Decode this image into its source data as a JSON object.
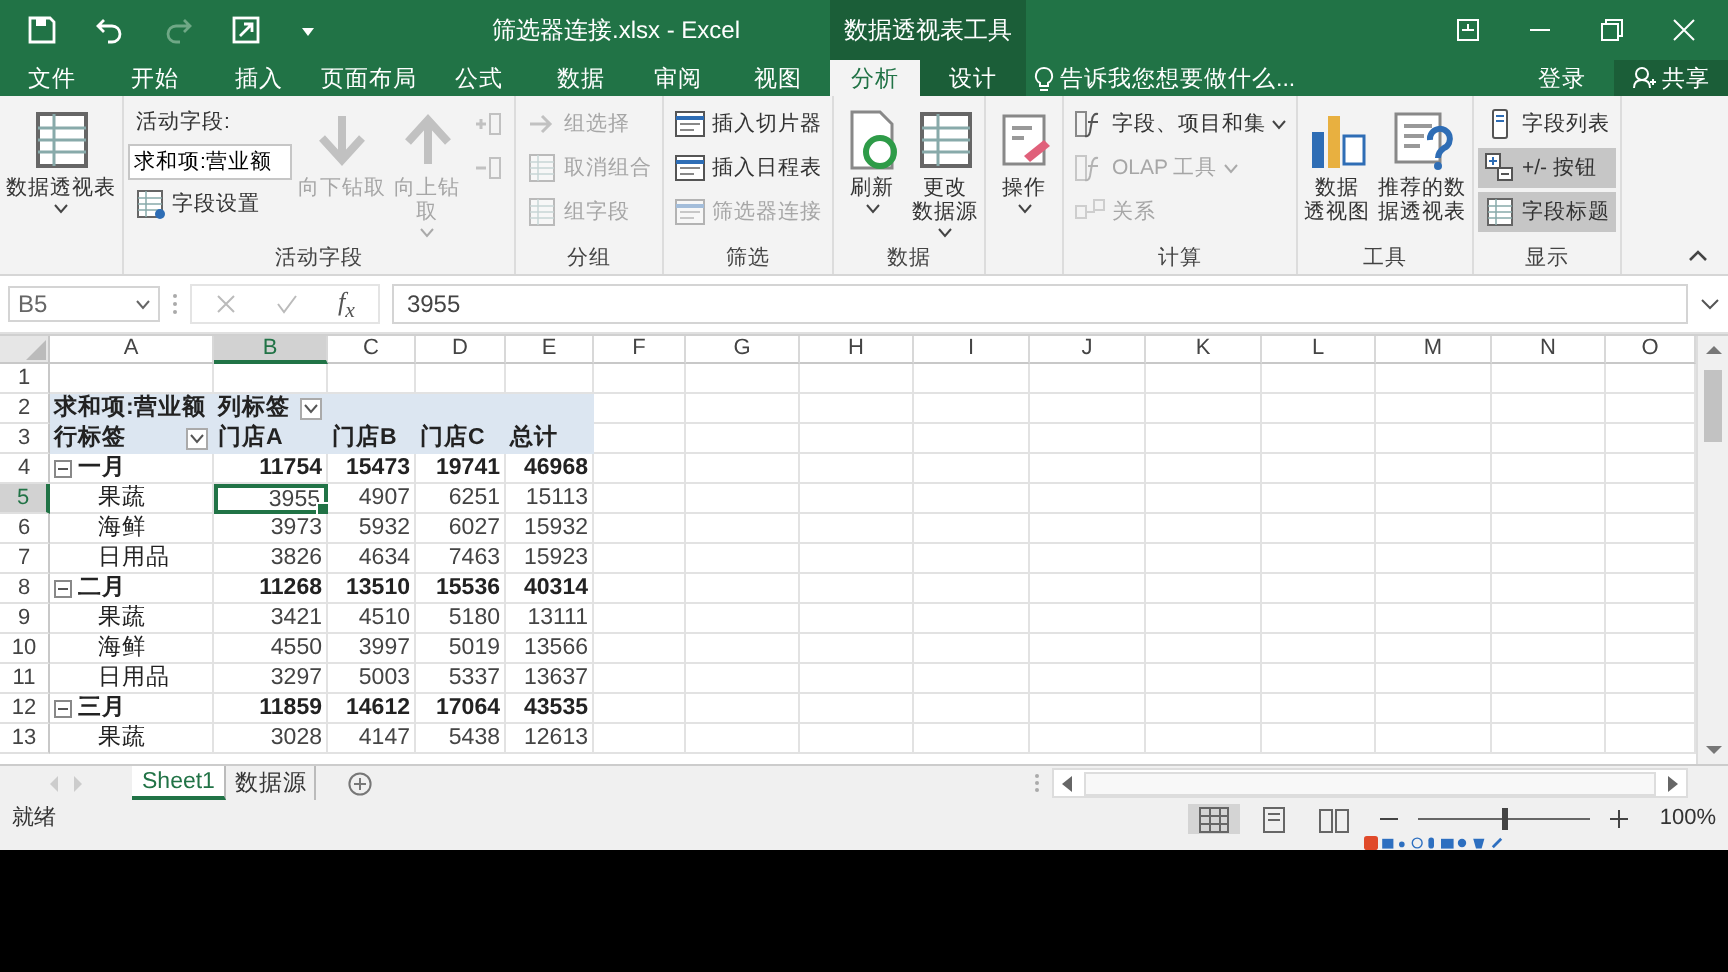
{
  "title_bar": {
    "title": "筛选器连接.xlsx - Excel",
    "context_label": "数据透视表工具"
  },
  "menu": {
    "tabs": [
      {
        "label": "文件",
        "selected": false,
        "contextual": false
      },
      {
        "label": "开始",
        "selected": false,
        "contextual": false
      },
      {
        "label": "插入",
        "selected": false,
        "contextual": false
      },
      {
        "label": "页面布局",
        "selected": false,
        "contextual": false
      },
      {
        "label": "公式",
        "selected": false,
        "contextual": false
      },
      {
        "label": "数据",
        "selected": false,
        "contextual": false
      },
      {
        "label": "审阅",
        "selected": false,
        "contextual": false
      },
      {
        "label": "视图",
        "selected": false,
        "contextual": false
      },
      {
        "label": "分析",
        "selected": true,
        "contextual": true
      },
      {
        "label": "设计",
        "selected": false,
        "contextual": true
      }
    ],
    "tell_me": "告诉我您想要做什么...",
    "sign_in": "登录",
    "share": "共享"
  },
  "ribbon": [
    {
      "items": [
        {
          "kind": "large",
          "label": "数据透视表",
          "disabled": false,
          "dropdown": true
        }
      ]
    },
    {
      "label": "活动字段",
      "items": [
        {
          "kind": "stack",
          "items": [
            {
              "kind": "caption",
              "label": "活动字段:"
            },
            {
              "kind": "field",
              "value": "求和项:营业额"
            },
            {
              "kind": "small",
              "label": "字段设置",
              "disabled": false
            }
          ]
        },
        {
          "kind": "large",
          "label": "向下钻取",
          "disabled": true,
          "dropdown": false
        },
        {
          "kind": "large",
          "label": "向上钻取",
          "disabled": true,
          "dropdown": true
        },
        {
          "kind": "stack",
          "items": [
            {
              "kind": "icon",
              "disabled": true
            },
            {
              "kind": "icon",
              "disabled": true
            }
          ]
        }
      ]
    },
    {
      "label": "分组",
      "items": [
        {
          "kind": "stack",
          "items": [
            {
              "kind": "small",
              "label": "组选择",
              "disabled": true
            },
            {
              "kind": "small",
              "label": "取消组合",
              "disabled": true
            },
            {
              "kind": "small",
              "label": "组字段",
              "disabled": true
            }
          ]
        }
      ]
    },
    {
      "label": "筛选",
      "items": [
        {
          "kind": "stack",
          "items": [
            {
              "kind": "small",
              "label": "插入切片器",
              "disabled": false
            },
            {
              "kind": "small",
              "label": "插入日程表",
              "disabled": false
            },
            {
              "kind": "small",
              "label": "筛选器连接",
              "disabled": true
            }
          ]
        }
      ]
    },
    {
      "label": "数据",
      "items": [
        {
          "kind": "large",
          "label": "刷新",
          "disabled": false,
          "dropdown": true
        },
        {
          "kind": "large",
          "label": "更改数据源",
          "disabled": false,
          "dropdown": true
        }
      ]
    },
    {
      "items": [
        {
          "kind": "large",
          "label": "操作",
          "disabled": false,
          "dropdown": true
        }
      ]
    },
    {
      "label": "计算",
      "items": [
        {
          "kind": "stack",
          "items": [
            {
              "kind": "small",
              "label": "字段、项目和集",
              "disabled": false,
              "dropdown": true
            },
            {
              "kind": "small",
              "label": "OLAP 工具",
              "disabled": true,
              "dropdown": true
            },
            {
              "kind": "small",
              "label": "关系",
              "disabled": true
            }
          ]
        }
      ]
    },
    {
      "label": "工具",
      "items": [
        {
          "kind": "large",
          "label": "数据透视图",
          "disabled": false,
          "dropdown": false
        },
        {
          "kind": "large",
          "label": "推荐的数据透视表",
          "disabled": false,
          "dropdown": false
        }
      ]
    },
    {
      "label": "显示",
      "items": [
        {
          "kind": "stack",
          "items": [
            {
              "kind": "small",
              "label": "字段列表",
              "disabled": false,
              "on": false
            },
            {
              "kind": "small",
              "label": "+/- 按钮",
              "disabled": false,
              "on": true
            },
            {
              "kind": "small",
              "label": "字段标题",
              "disabled": false,
              "on": true
            }
          ]
        }
      ]
    }
  ],
  "formula_bar": {
    "name_box": "B5",
    "fx": "f$_{x}$",
    "value": "3955"
  },
  "columns": [
    {
      "label": "A",
      "selected": false
    },
    {
      "label": "B",
      "selected": true
    },
    {
      "label": "C",
      "selected": false
    },
    {
      "label": "D",
      "selected": false
    },
    {
      "label": "E",
      "selected": false
    },
    {
      "label": "F",
      "selected": false
    },
    {
      "label": "G",
      "selected": false
    },
    {
      "label": "H",
      "selected": false
    },
    {
      "label": "I",
      "selected": false
    },
    {
      "label": "J",
      "selected": false
    },
    {
      "label": "K",
      "selected": false
    },
    {
      "label": "L",
      "selected": false
    },
    {
      "label": "M",
      "selected": false
    },
    {
      "label": "N",
      "selected": false
    },
    {
      "label": "O",
      "selected": false
    }
  ],
  "rows": [
    {
      "num": "1",
      "kind": "blank",
      "selected": false,
      "cells": []
    },
    {
      "num": "2",
      "kind": "pivot_header",
      "selected": false,
      "cells": [
        "求和项:营业额",
        {
          "text": "列标签",
          "filter": true
        }
      ]
    },
    {
      "num": "3",
      "kind": "pivot_header",
      "selected": false,
      "cells": [
        {
          "text": "行标签",
          "filter": true
        },
        "门店A",
        "门店B",
        "门店C",
        "总计"
      ]
    },
    {
      "num": "4",
      "kind": "group",
      "selected": false,
      "expanded": true,
      "cells": [
        "一月",
        "11754",
        "15473",
        "19741",
        "46968"
      ]
    },
    {
      "num": "5",
      "kind": "item",
      "selected": true,
      "cells": [
        "果蔬",
        "3955",
        "4907",
        "6251",
        "15113"
      ]
    },
    {
      "num": "6",
      "kind": "item",
      "selected": false,
      "cells": [
        "海鲜",
        "3973",
        "5932",
        "6027",
        "15932"
      ]
    },
    {
      "num": "7",
      "kind": "item",
      "selected": false,
      "cells": [
        "日用品",
        "3826",
        "4634",
        "7463",
        "15923"
      ]
    },
    {
      "num": "8",
      "kind": "group",
      "selected": false,
      "expanded": true,
      "cells": [
        "二月",
        "11268",
        "13510",
        "15536",
        "40314"
      ]
    },
    {
      "num": "9",
      "kind": "item",
      "selected": false,
      "cells": [
        "果蔬",
        "3421",
        "4510",
        "5180",
        "13111"
      ]
    },
    {
      "num": "10",
      "kind": "item",
      "selected": false,
      "cells": [
        "海鲜",
        "4550",
        "3997",
        "5019",
        "13566"
      ]
    },
    {
      "num": "11",
      "kind": "item",
      "selected": false,
      "cells": [
        "日用品",
        "3297",
        "5003",
        "5337",
        "13637"
      ]
    },
    {
      "num": "12",
      "kind": "group",
      "selected": false,
      "expanded": true,
      "cells": [
        "三月",
        "11859",
        "14612",
        "17064",
        "43535"
      ]
    },
    {
      "num": "13",
      "kind": "item",
      "selected": false,
      "cells": [
        "果蔬",
        "3028",
        "4147",
        "5438",
        "12613"
      ]
    }
  ],
  "sheet_tabs": [
    {
      "label": "Sheet1",
      "selected": true
    },
    {
      "label": "数据源",
      "selected": false
    }
  ],
  "status_bar": {
    "text": "就绪",
    "views": [
      {
        "selected": true
      },
      {
        "selected": false
      },
      {
        "selected": false
      }
    ],
    "zoom": {
      "level": 0.5,
      "text": "100%"
    }
  }
}
